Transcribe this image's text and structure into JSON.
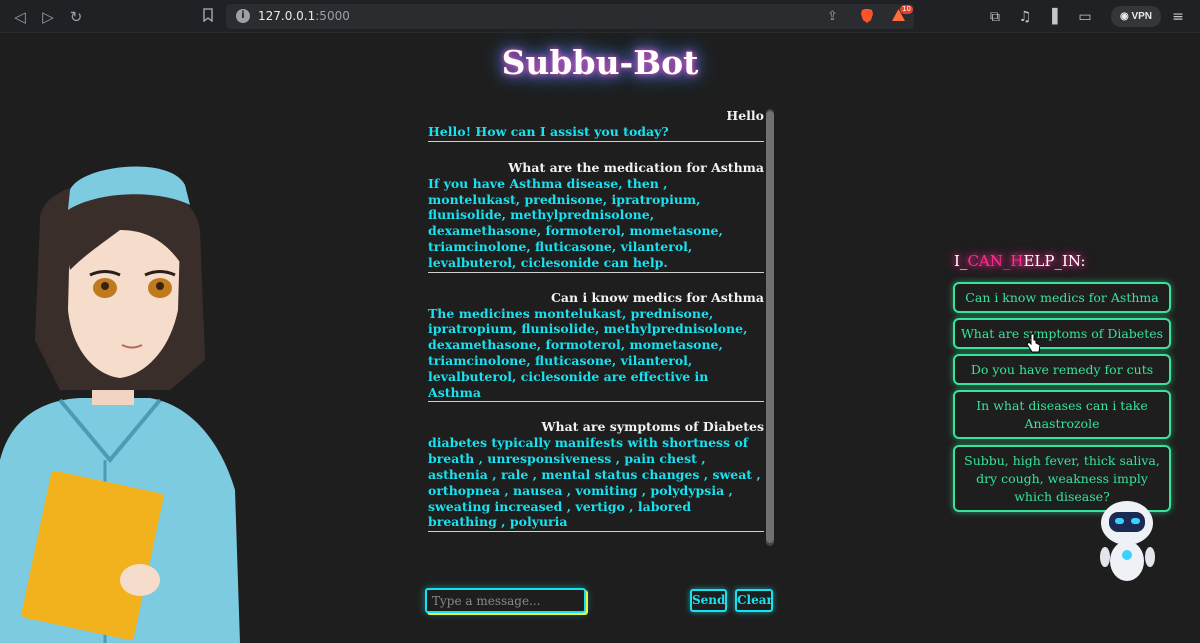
{
  "browser": {
    "url_host": "127.0.0.1",
    "url_port": ":5000",
    "notification_count": "10",
    "vpn_label": "VPN"
  },
  "app": {
    "title": "Subbu-Bot"
  },
  "chat": {
    "messages": [
      {
        "user": "Hello",
        "bot": "Hello! How can I assist you today?"
      },
      {
        "user": "What are the medication for Asthma",
        "bot": "If you have Asthma disease, then , montelukast, prednisone, ipratropium, flunisolide, methylprednisolone, dexamethasone, formoterol, mometasone, triamcinolone, fluticasone, vilanterol, levalbuterol, ciclesonide can help."
      },
      {
        "user": "Can i know medics for Asthma",
        "bot": "The medicines montelukast, prednisone, ipratropium, flunisolide, methylprednisolone, dexamethasone, formoterol, mometasone, triamcinolone, fluticasone, vilanterol, levalbuterol, ciclesonide are effective in Asthma"
      },
      {
        "user": "What are symptoms of Diabetes",
        "bot": "diabetes typically manifests with shortness of breath , unresponsiveness , pain chest , asthenia , rale , mental status changes , sweat , orthopnea , nausea , vomiting , polydypsia , sweating increased , vertigo , labored breathing , polyuria"
      }
    ]
  },
  "input": {
    "placeholder": "Type a message...",
    "value": ""
  },
  "buttons": {
    "send": "Send",
    "clear": "Clear"
  },
  "help": {
    "title": "I_CAN_HELP_IN:",
    "suggestions": [
      "Can i know medics for Asthma",
      "What are symptoms of Diabetes",
      "Do you have remedy for cuts",
      "In what diseases can i take Anastrozole",
      "Subbu, high fever, thick saliva, dry cough, weakness imply which disease?"
    ]
  },
  "colors": {
    "bot_text": "#19e2f0",
    "user_text": "#f2f2f2",
    "suggestion": "#36e49a",
    "title_glow": "#ff4fa8"
  }
}
